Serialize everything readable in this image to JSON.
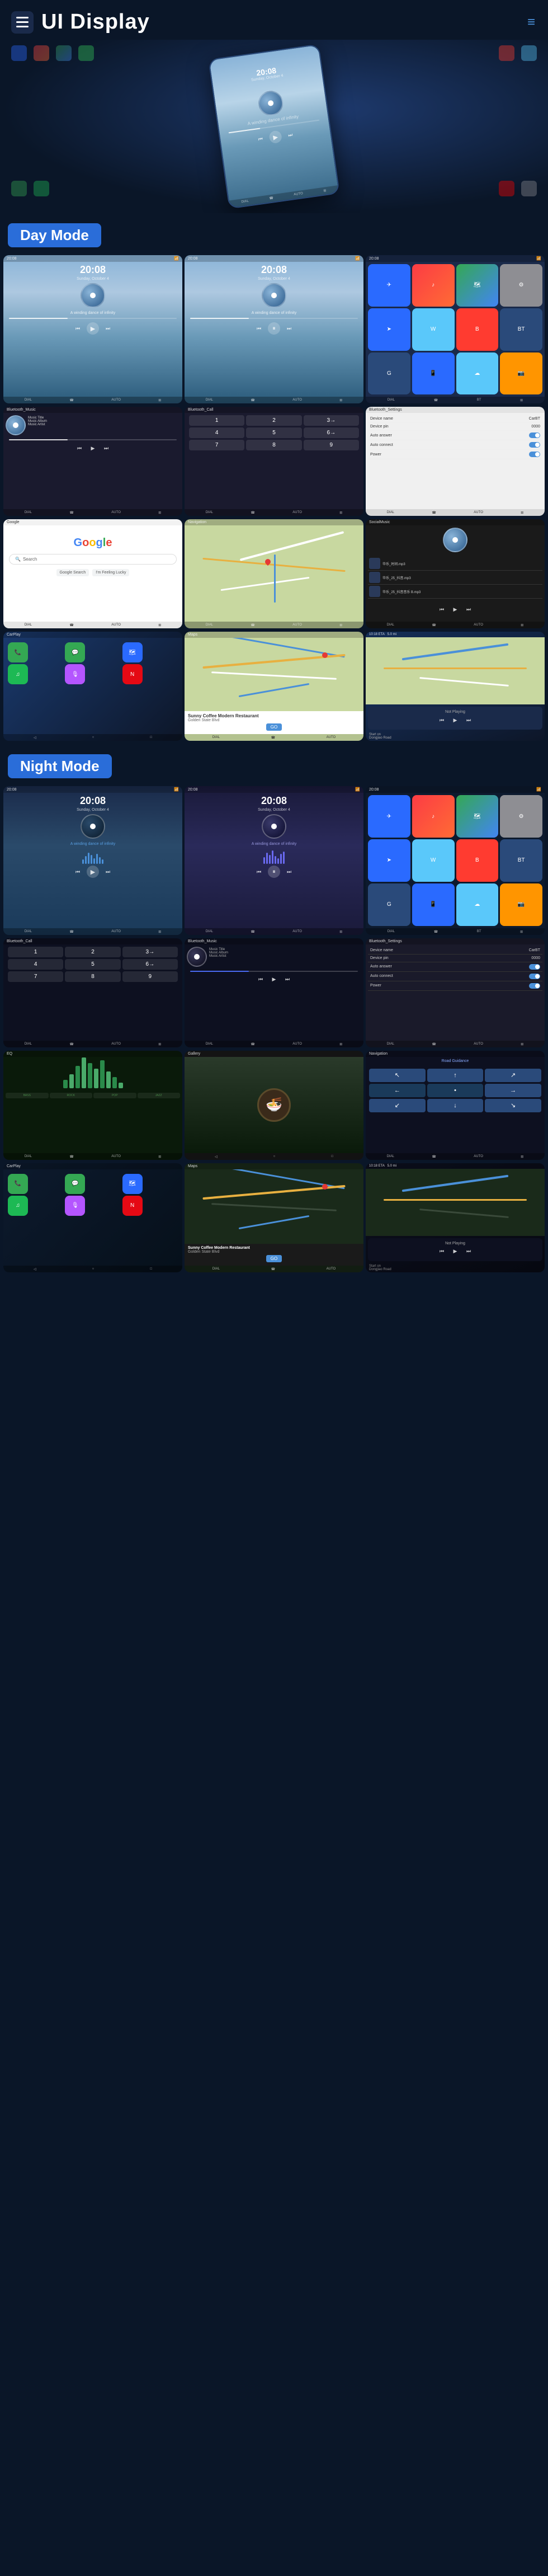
{
  "header": {
    "title": "UI Display",
    "menu_label": "menu",
    "nav_dots_label": "navigation"
  },
  "day_mode": {
    "label": "Day Mode"
  },
  "night_mode": {
    "label": "Night Mode"
  },
  "screens": {
    "time": "20:08",
    "subtitle": "Sunday, October 4",
    "music_title": "Music Title",
    "music_album": "Music Album",
    "music_artist": "Music Artist",
    "bluetooth_music": "Bluetooth_Music",
    "bluetooth_call": "Bluetooth_Call",
    "bluetooth_settings": "Bluetooth_Settings",
    "device_name_label": "Device name",
    "device_name_value": "CarBT",
    "device_pin_label": "Device pin",
    "device_pin_value": "0000",
    "auto_answer_label": "Auto answer",
    "auto_connect_label": "Auto connect",
    "power_label": "Power",
    "social_music": "SocialMusic",
    "google_text": "Google",
    "not_playing": "Not Playing",
    "coffee_name": "Sunny Coffee Modern Restaurant",
    "coffee_address": "Golden State Blvd",
    "eta_label": "10:18 ETA",
    "distance_label": "5.0 mi",
    "go_label": "GO",
    "start_on": "Start on",
    "dongnan_road": "Dongjiao Road"
  }
}
